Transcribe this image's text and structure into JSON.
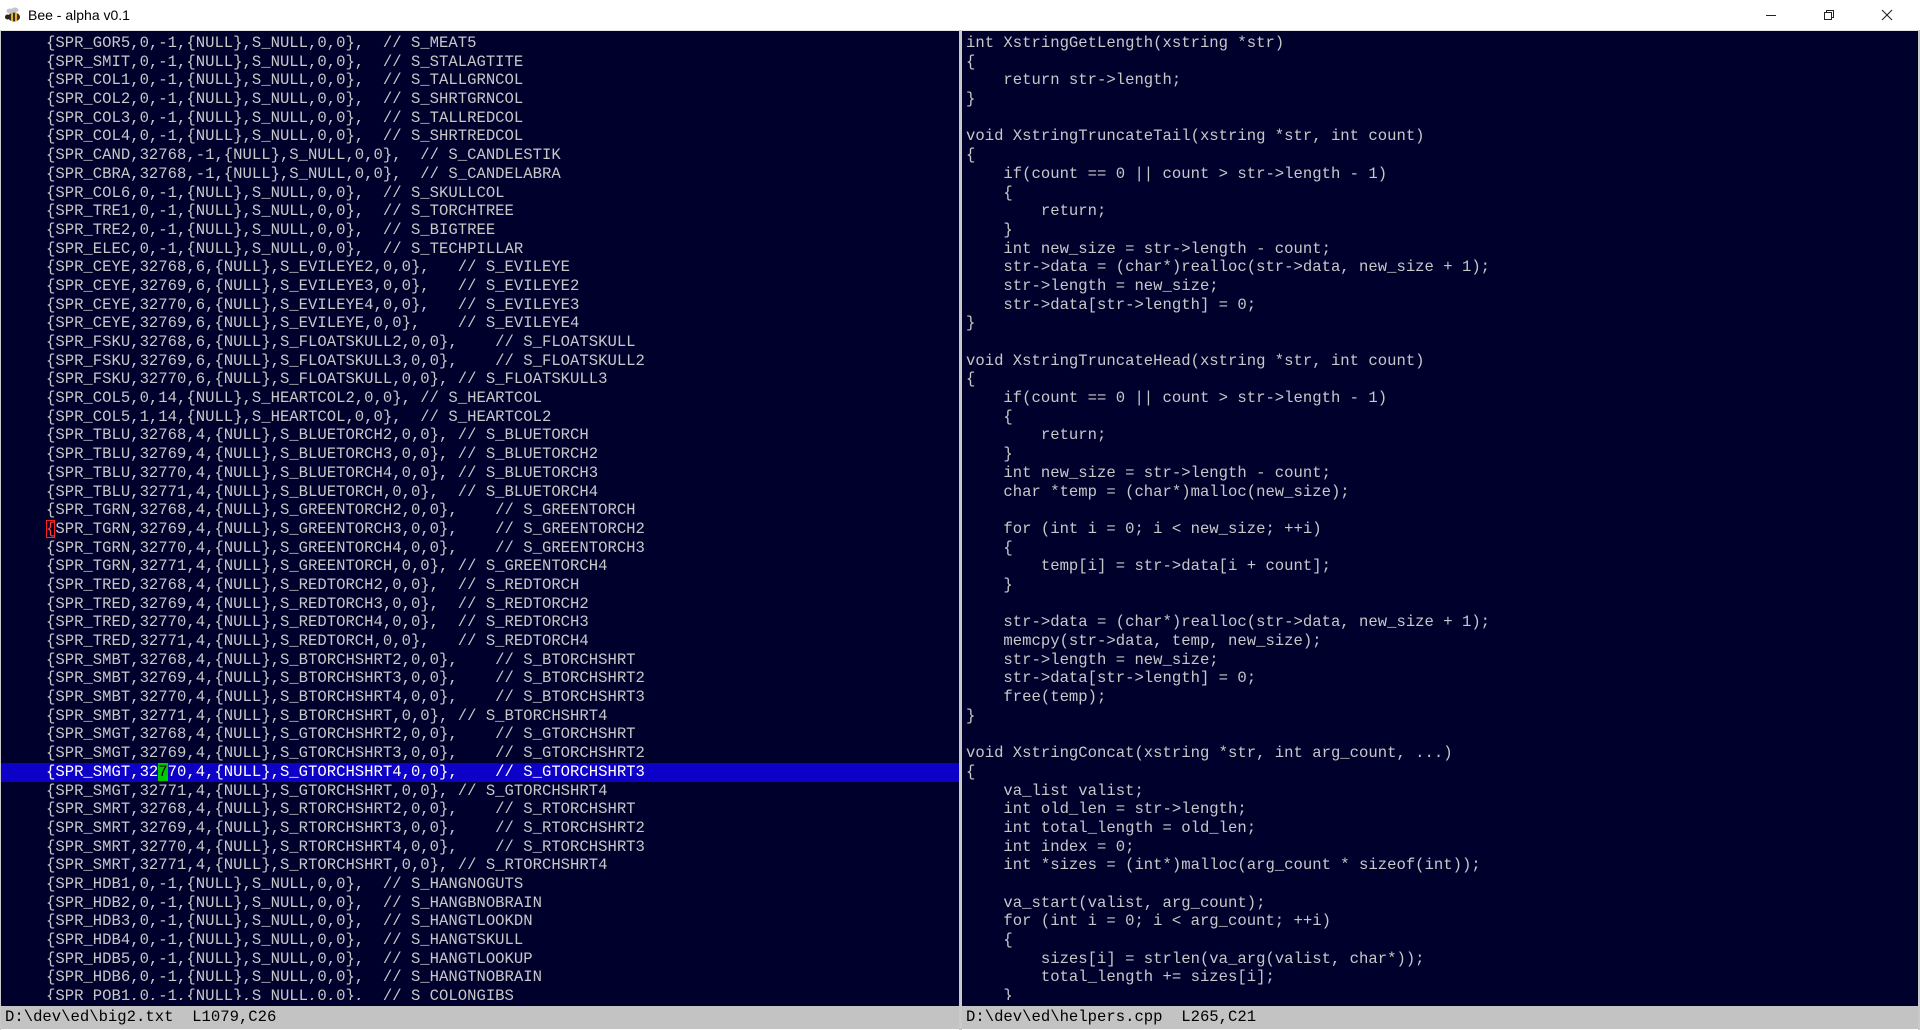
{
  "window": {
    "title": "Bee - alpha v0.1",
    "icon": "bee-icon",
    "controls": [
      "minimize-icon",
      "restore-icon",
      "close-icon"
    ]
  },
  "left_pane": {
    "current_line_index": 39,
    "cursor": {
      "line": 39,
      "col": 12
    },
    "mark": {
      "line": 26,
      "col": 0
    },
    "lines": [
      "{SPR_GOR5,0,-1,{NULL},S_NULL,0,0},  // S_MEAT5",
      "{SPR_SMIT,0,-1,{NULL},S_NULL,0,0},  // S_STALAGTITE",
      "{SPR_COL1,0,-1,{NULL},S_NULL,0,0},  // S_TALLGRNCOL",
      "{SPR_COL2,0,-1,{NULL},S_NULL,0,0},  // S_SHRTGRNCOL",
      "{SPR_COL3,0,-1,{NULL},S_NULL,0,0},  // S_TALLREDCOL",
      "{SPR_COL4,0,-1,{NULL},S_NULL,0,0},  // S_SHRTREDCOL",
      "{SPR_CAND,32768,-1,{NULL},S_NULL,0,0},  // S_CANDLESTIK",
      "{SPR_CBRA,32768,-1,{NULL},S_NULL,0,0},  // S_CANDELABRA",
      "{SPR_COL6,0,-1,{NULL},S_NULL,0,0},  // S_SKULLCOL",
      "{SPR_TRE1,0,-1,{NULL},S_NULL,0,0},  // S_TORCHTREE",
      "{SPR_TRE2,0,-1,{NULL},S_NULL,0,0},  // S_BIGTREE",
      "{SPR_ELEC,0,-1,{NULL},S_NULL,0,0},  // S_TECHPILLAR",
      "{SPR_CEYE,32768,6,{NULL},S_EVILEYE2,0,0},   // S_EVILEYE",
      "{SPR_CEYE,32769,6,{NULL},S_EVILEYE3,0,0},   // S_EVILEYE2",
      "{SPR_CEYE,32770,6,{NULL},S_EVILEYE4,0,0},   // S_EVILEYE3",
      "{SPR_CEYE,32769,6,{NULL},S_EVILEYE,0,0},    // S_EVILEYE4",
      "{SPR_FSKU,32768,6,{NULL},S_FLOATSKULL2,0,0},    // S_FLOATSKULL",
      "{SPR_FSKU,32769,6,{NULL},S_FLOATSKULL3,0,0},    // S_FLOATSKULL2",
      "{SPR_FSKU,32770,6,{NULL},S_FLOATSKULL,0,0}, // S_FLOATSKULL3",
      "{SPR_COL5,0,14,{NULL},S_HEARTCOL2,0,0}, // S_HEARTCOL",
      "{SPR_COL5,1,14,{NULL},S_HEARTCOL,0,0},  // S_HEARTCOL2",
      "{SPR_TBLU,32768,4,{NULL},S_BLUETORCH2,0,0}, // S_BLUETORCH",
      "{SPR_TBLU,32769,4,{NULL},S_BLUETORCH3,0,0}, // S_BLUETORCH2",
      "{SPR_TBLU,32770,4,{NULL},S_BLUETORCH4,0,0}, // S_BLUETORCH3",
      "{SPR_TBLU,32771,4,{NULL},S_BLUETORCH,0,0},  // S_BLUETORCH4",
      "{SPR_TGRN,32768,4,{NULL},S_GREENTORCH2,0,0},    // S_GREENTORCH",
      "{SPR_TGRN,32769,4,{NULL},S_GREENTORCH3,0,0},    // S_GREENTORCH2",
      "{SPR_TGRN,32770,4,{NULL},S_GREENTORCH4,0,0},    // S_GREENTORCH3",
      "{SPR_TGRN,32771,4,{NULL},S_GREENTORCH,0,0}, // S_GREENTORCH4",
      "{SPR_TRED,32768,4,{NULL},S_REDTORCH2,0,0},  // S_REDTORCH",
      "{SPR_TRED,32769,4,{NULL},S_REDTORCH3,0,0},  // S_REDTORCH2",
      "{SPR_TRED,32770,4,{NULL},S_REDTORCH4,0,0},  // S_REDTORCH3",
      "{SPR_TRED,32771,4,{NULL},S_REDTORCH,0,0},   // S_REDTORCH4",
      "{SPR_SMBT,32768,4,{NULL},S_BTORCHSHRT2,0,0},    // S_BTORCHSHRT",
      "{SPR_SMBT,32769,4,{NULL},S_BTORCHSHRT3,0,0},    // S_BTORCHSHRT2",
      "{SPR_SMBT,32770,4,{NULL},S_BTORCHSHRT4,0,0},    // S_BTORCHSHRT3",
      "{SPR_SMBT,32771,4,{NULL},S_BTORCHSHRT,0,0}, // S_BTORCHSHRT4",
      "{SPR_SMGT,32768,4,{NULL},S_GTORCHSHRT2,0,0},    // S_GTORCHSHRT",
      "{SPR_SMGT,32769,4,{NULL},S_GTORCHSHRT3,0,0},    // S_GTORCHSHRT2",
      "{SPR_SMGT,32770,4,{NULL},S_GTORCHSHRT4,0,0},    // S_GTORCHSHRT3",
      "{SPR_SMGT,32771,4,{NULL},S_GTORCHSHRT,0,0}, // S_GTORCHSHRT4",
      "{SPR_SMRT,32768,4,{NULL},S_RTORCHSHRT2,0,0},    // S_RTORCHSHRT",
      "{SPR_SMRT,32769,4,{NULL},S_RTORCHSHRT3,0,0},    // S_RTORCHSHRT2",
      "{SPR_SMRT,32770,4,{NULL},S_RTORCHSHRT4,0,0},    // S_RTORCHSHRT3",
      "{SPR_SMRT,32771,4,{NULL},S_RTORCHSHRT,0,0}, // S_RTORCHSHRT4",
      "{SPR_HDB1,0,-1,{NULL},S_NULL,0,0},  // S_HANGNOGUTS",
      "{SPR_HDB2,0,-1,{NULL},S_NULL,0,0},  // S_HANGBNOBRAIN",
      "{SPR_HDB3,0,-1,{NULL},S_NULL,0,0},  // S_HANGTLOOKDN",
      "{SPR_HDB4,0,-1,{NULL},S_NULL,0,0},  // S_HANGTSKULL",
      "{SPR_HDB5,0,-1,{NULL},S_NULL,0,0},  // S_HANGTLOOKUP",
      "{SPR_HDB6,0,-1,{NULL},S_NULL,0,0},  // S_HANGTNOBRAIN",
      "{SPR_POB1,0,-1,{NULL},S_NULL,0,0},  // S_COLONGIBS"
    ],
    "status": "D:\\dev\\ed\\big2.txt  L1079,C26"
  },
  "right_pane": {
    "lines": [
      "int XstringGetLength(xstring *str)",
      "{",
      "    return str->length;",
      "}",
      "",
      "void XstringTruncateTail(xstring *str, int count)",
      "{",
      "    if(count == 0 || count > str->length - 1)",
      "    {",
      "        return;",
      "    }",
      "    int new_size = str->length - count;",
      "    str->data = (char*)realloc(str->data, new_size + 1);",
      "    str->length = new_size;",
      "    str->data[str->length] = 0;",
      "}",
      "",
      "void XstringTruncateHead(xstring *str, int count)",
      "{",
      "    if(count == 0 || count > str->length - 1)",
      "    {",
      "        return;",
      "    }",
      "    int new_size = str->length - count;",
      "    char *temp = (char*)malloc(new_size);",
      "",
      "    for (int i = 0; i < new_size; ++i)",
      "    {",
      "        temp[i] = str->data[i + count];",
      "    }",
      "",
      "    str->data = (char*)realloc(str->data, new_size + 1);",
      "    memcpy(str->data, temp, new_size);",
      "    str->length = new_size;",
      "    str->data[str->length] = 0;",
      "    free(temp);",
      "}",
      "",
      "void XstringConcat(xstring *str, int arg_count, ...)",
      "{",
      "    va_list valist;",
      "    int old_len = str->length;",
      "    int total_length = old_len;",
      "    int index = 0;",
      "    int *sizes = (int*)malloc(arg_count * sizeof(int));",
      "",
      "    va_start(valist, arg_count);",
      "    for (int i = 0; i < arg_count; ++i)",
      "    {",
      "        sizes[i] = strlen(va_arg(valist, char*));",
      "        total_length += sizes[i];",
      "    }"
    ],
    "status": "D:\\dev\\ed\\helpers.cpp  L265,C21"
  },
  "colors": {
    "editor_bg": "#00002d",
    "text": "#c8c8c8",
    "current_line_bg": "#0d00c7",
    "cursor": "#00c800",
    "mark": "#ff2020",
    "status_bg": "#c3c3c3"
  }
}
